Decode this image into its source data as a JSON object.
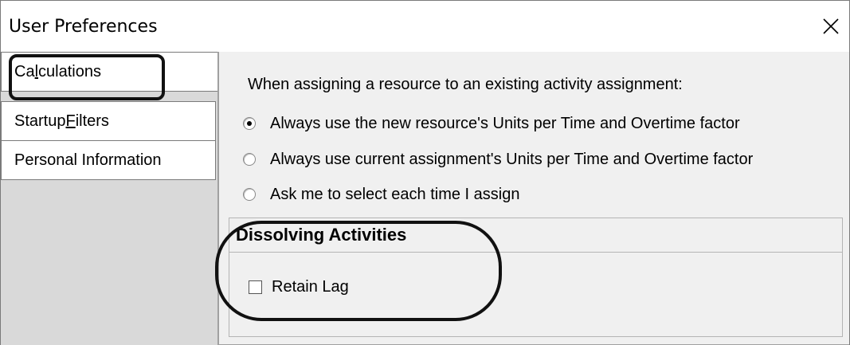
{
  "window": {
    "title": "User Preferences",
    "close_icon": "close-icon"
  },
  "sidebar": {
    "tabs": [
      {
        "label_pre": "Ca",
        "label_ul": "l",
        "label_post": "culations",
        "active": true
      },
      {
        "label_pre": "Startup ",
        "label_ul": "F",
        "label_post": "ilters",
        "active": false
      },
      {
        "label_pre": "Personal Information",
        "label_ul": "",
        "label_post": "",
        "active": false
      }
    ]
  },
  "calculations": {
    "prompt": "When assigning a resource to an existing activity assignment:",
    "options": [
      {
        "label": "Always use the new resource's Units per Time and Overtime factor",
        "checked": true
      },
      {
        "label": "Always use current assignment's Units per Time and Overtime factor",
        "checked": false
      },
      {
        "label": "Ask me to select each time I assign",
        "checked": false
      }
    ],
    "dissolving": {
      "header": "Dissolving Activities",
      "retain_lag_label": "Retain Lag",
      "retain_lag_checked": false
    }
  },
  "colors": {
    "window_bg": "#f0f0f0",
    "sidebar_bg": "#d9d9d9",
    "tab_bg": "#ffffff",
    "annotation": "#111111"
  }
}
